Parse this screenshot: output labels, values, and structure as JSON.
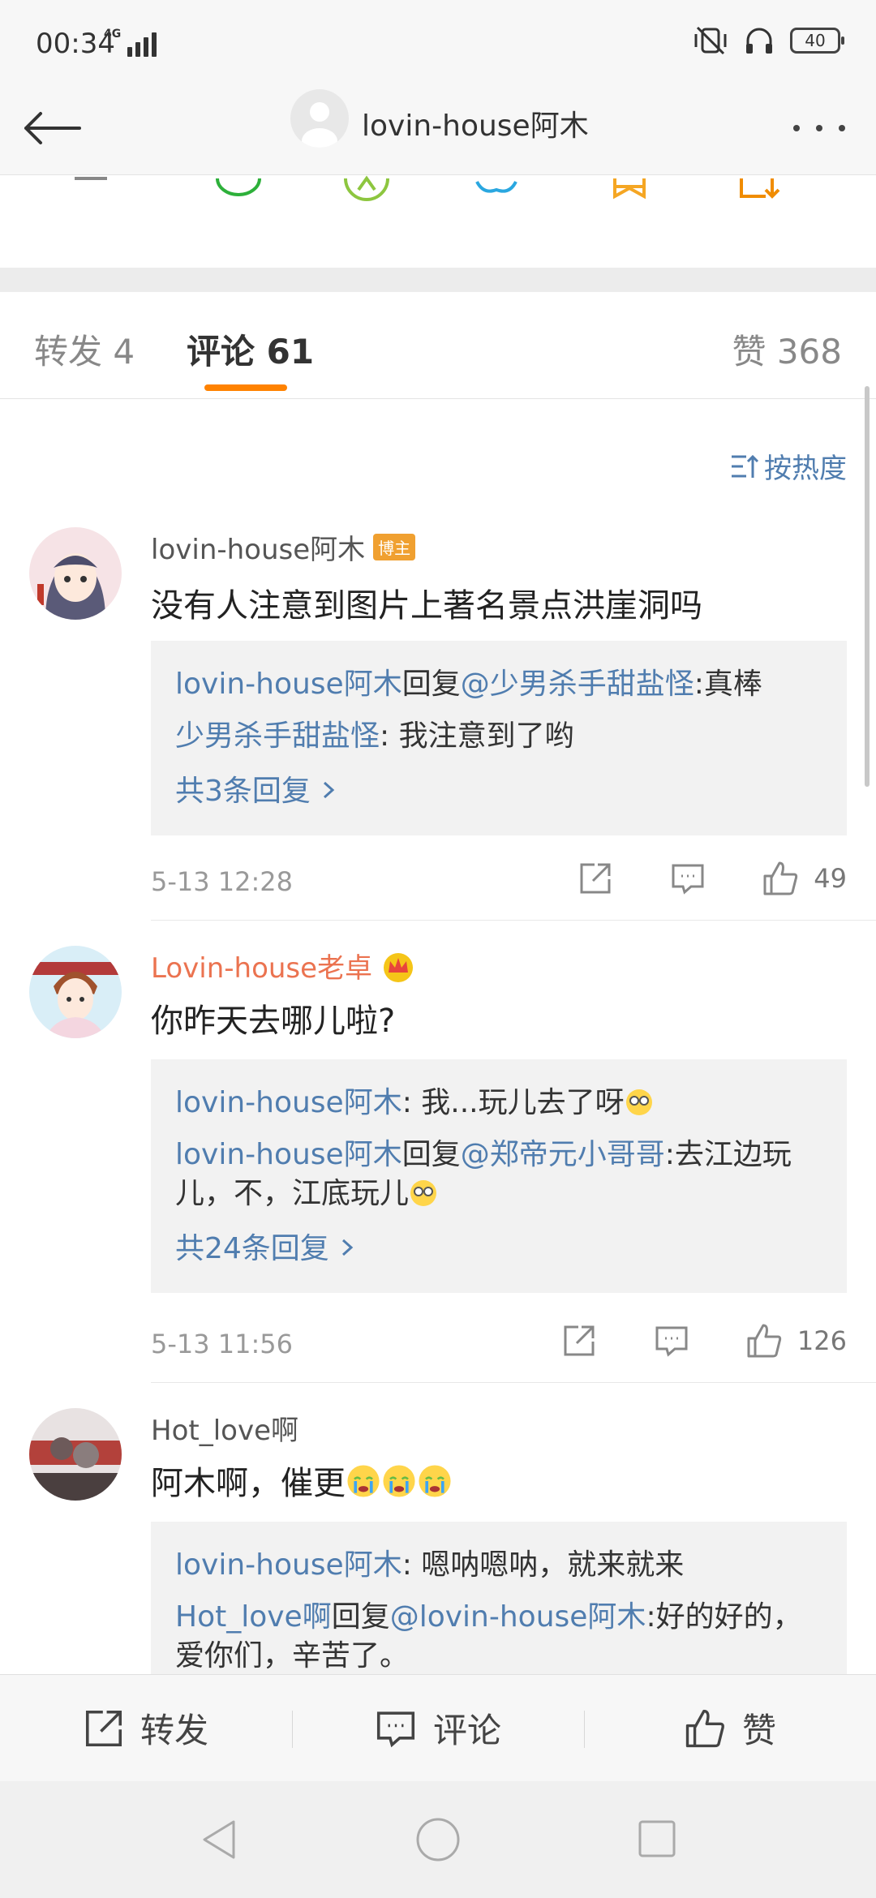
{
  "status_bar": {
    "time": "00:34",
    "network": "4G",
    "battery": "40"
  },
  "header": {
    "title": "lovin-house阿木"
  },
  "tabs": {
    "repost": "转发 4",
    "comments": "评论 61",
    "likes": "赞 368"
  },
  "sort": {
    "label": "按热度"
  },
  "comments": [
    {
      "name": "lovin-house阿木",
      "badge": "博主",
      "text": "没有人注意到图片上著名景点洪崖洞吗",
      "replies": [
        {
          "user": "lovin-house阿木",
          "mid": "回复",
          "target": "@少男杀手甜盐怪",
          "text": ":真棒"
        },
        {
          "user": "少男杀手甜盐怪",
          "text": ": 我注意到了哟"
        }
      ],
      "more": "共3条回复",
      "time": "5-13 12:28",
      "likes": "49"
    },
    {
      "name": "Lovin-house老卓",
      "text": "你昨天去哪儿啦?",
      "replies": [
        {
          "user": "lovin-house阿木",
          "text": ": 我...玩儿去了呀"
        },
        {
          "user": "lovin-house阿木",
          "mid": "回复",
          "target": "@郑帝元小哥哥",
          "text": ":去江边玩",
          "text2": "儿，不，江底玩儿"
        }
      ],
      "more": "共24条回复",
      "time": "5-13 11:56",
      "likes": "126"
    },
    {
      "name": "Hot_love啊",
      "text": "阿木啊，催更",
      "replies": [
        {
          "user": "lovin-house阿木",
          "text": ": 嗯呐嗯呐，就来就来"
        },
        {
          "user": "Hot_love啊",
          "mid": "回复",
          "target": "@lovin-house阿木",
          "text": ":好的好的，",
          "text2": "爱你们，辛苦了。"
        }
      ]
    }
  ],
  "bottom_bar": {
    "repost": "转发",
    "comment": "评论",
    "like": "赞"
  },
  "colors": {
    "accent": "#ff8200",
    "link": "#507daf",
    "vip_name": "#eb7350"
  }
}
